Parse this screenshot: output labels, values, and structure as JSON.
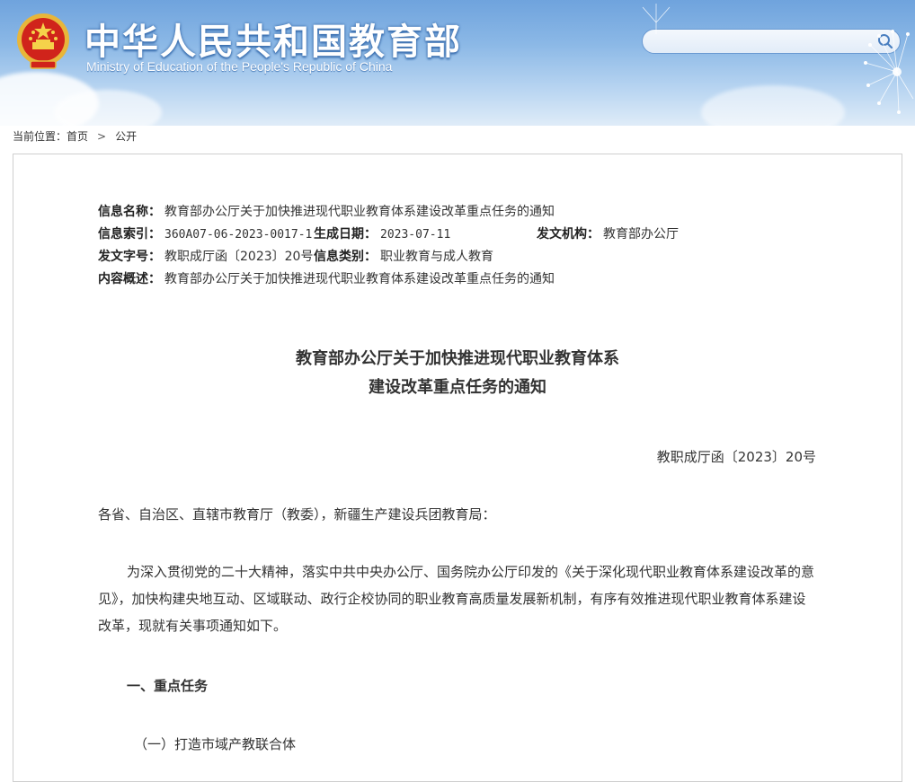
{
  "header": {
    "title_cn": "中华人民共和国教育部",
    "title_en": "Ministry of Education of the People's Republic of China",
    "search_placeholder": "",
    "emblem_icon": "national-emblem-icon",
    "search_icon": "search-icon"
  },
  "breadcrumb": {
    "label": "当前位置：",
    "items": [
      "首页",
      "公开"
    ],
    "separator": ">"
  },
  "meta": {
    "name_label": "信息名称：",
    "name_value": "教育部办公厅关于加快推进现代职业教育体系建设改革重点任务的通知",
    "index_label": "信息索引：",
    "index_value": "360A07-06-2023-0017-1",
    "date_label": "生成日期：",
    "date_value": "2023-07-11",
    "org_label": "发文机构：",
    "org_value": "教育部办公厅",
    "docno_label": "发文字号：",
    "docno_value": "教职成厅函〔2023〕20号",
    "category_label": "信息类别：",
    "category_value": "职业教育与成人教育",
    "summary_label": "内容概述：",
    "summary_value": "教育部办公厅关于加快推进现代职业教育体系建设改革重点任务的通知"
  },
  "document": {
    "title_line1": "教育部办公厅关于加快推进现代职业教育体系",
    "title_line2": "建设改革重点任务的通知",
    "doc_number": "教职成厅函〔2023〕20号",
    "salutation": "各省、自治区、直辖市教育厅（教委），新疆生产建设兵团教育局：",
    "intro": "为深入贯彻党的二十大精神，落实中共中央办公厅、国务院办公厅印发的《关于深化现代职业教育体系建设改革的意见》，加快构建央地互动、区域联动、政行企校协同的职业教育高质量发展新机制，有序有效推进现代职业教育体系建设改革，现就有关事项通知如下。",
    "heading1": "一、重点任务",
    "heading2": "（一）打造市域产教联合体"
  },
  "colors": {
    "header_sky": "#8bb8e6",
    "title_text": "#ffffff",
    "border": "#cfcfcf"
  }
}
